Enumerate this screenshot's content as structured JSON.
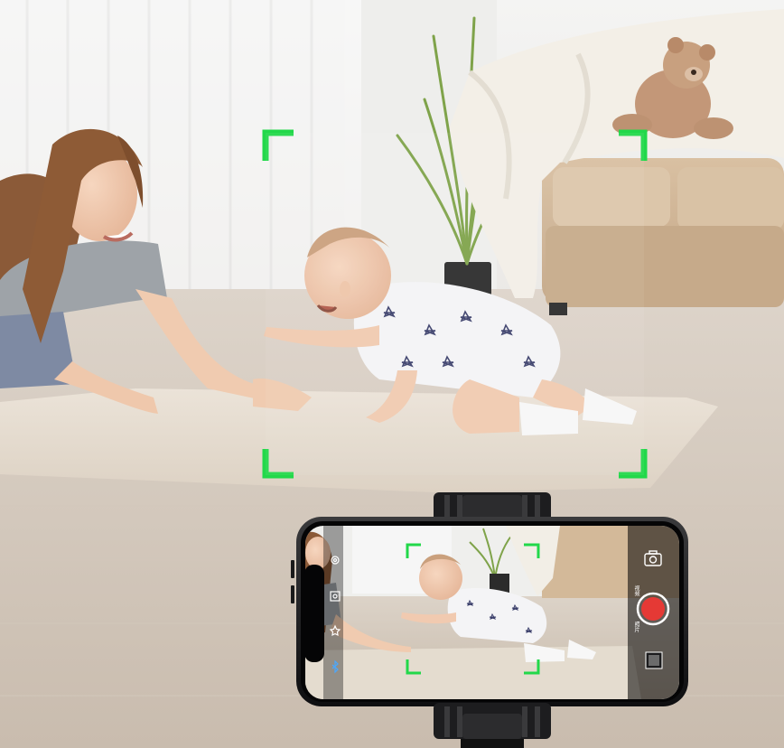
{
  "scene": {
    "description_icons": [
      "settings-icon",
      "face-track-icon",
      "star-icon",
      "bluetooth-icon",
      "flip-camera-icon",
      "shutter-button",
      "gallery-thumbnail"
    ],
    "tracking_frame_color": "#22d84a",
    "record_button_color": "#e53935"
  },
  "camera_ui": {
    "mode_video": "视频",
    "mode_photo": "照片"
  }
}
